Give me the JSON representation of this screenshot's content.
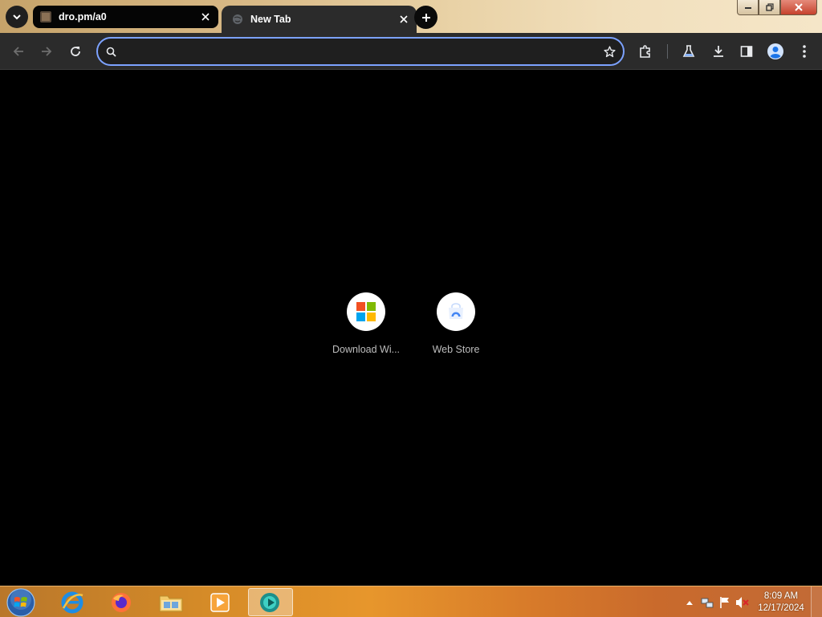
{
  "browser": {
    "tabs": [
      {
        "title": "dro.pm/a0",
        "active": false
      },
      {
        "title": "New Tab",
        "active": true
      }
    ],
    "omnibox": {
      "value": "",
      "placeholder": ""
    },
    "accent_color": "#7ca2ff"
  },
  "new_tab_page": {
    "shortcuts": [
      {
        "label": "Download Wi...",
        "icon": "windows-logo-icon"
      },
      {
        "label": "Web Store",
        "icon": "web-store-icon"
      }
    ]
  },
  "taskbar": {
    "apps": [
      {
        "name": "internet-explorer-icon"
      },
      {
        "name": "firefox-icon"
      },
      {
        "name": "file-explorer-icon"
      },
      {
        "name": "media-player-icon"
      },
      {
        "name": "chrome-app-icon",
        "active": true
      }
    ],
    "clock": {
      "time": "8:09 AM",
      "date": "12/17/2024"
    }
  }
}
